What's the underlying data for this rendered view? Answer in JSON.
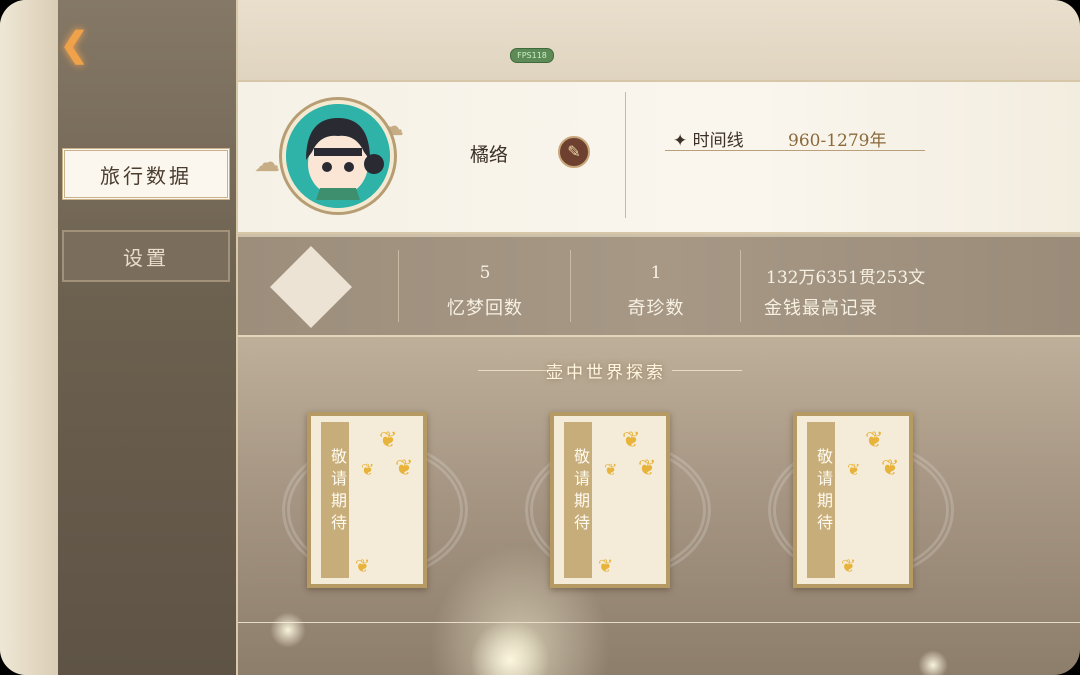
{
  "app": {
    "fps_badge": "FPS118",
    "back_icon": "back-arrow-icon"
  },
  "sidebar": {
    "tabs": [
      {
        "label": "旅行数据",
        "active": true
      },
      {
        "label": "设置",
        "active": false
      }
    ]
  },
  "profile": {
    "name": "橘络",
    "edit_icon": "brush-icon",
    "timeline_label": "时间线",
    "timeline_value": "960-1279年"
  },
  "stats": [
    {
      "value": "5",
      "label": "忆梦回数"
    },
    {
      "value": "1",
      "label": "奇珍数"
    },
    {
      "value": "132万6351贯253文",
      "label": "金钱最高记录"
    }
  ],
  "exploration": {
    "title": "壶中世界探索",
    "cards": [
      {
        "text": "敬请期待"
      },
      {
        "text": "敬请期待"
      },
      {
        "text": "敬请期待"
      }
    ]
  },
  "colors": {
    "accent": "#b69a64",
    "avatar_bg": "#2fb3a8",
    "back_arrow": "#f0a24a"
  }
}
